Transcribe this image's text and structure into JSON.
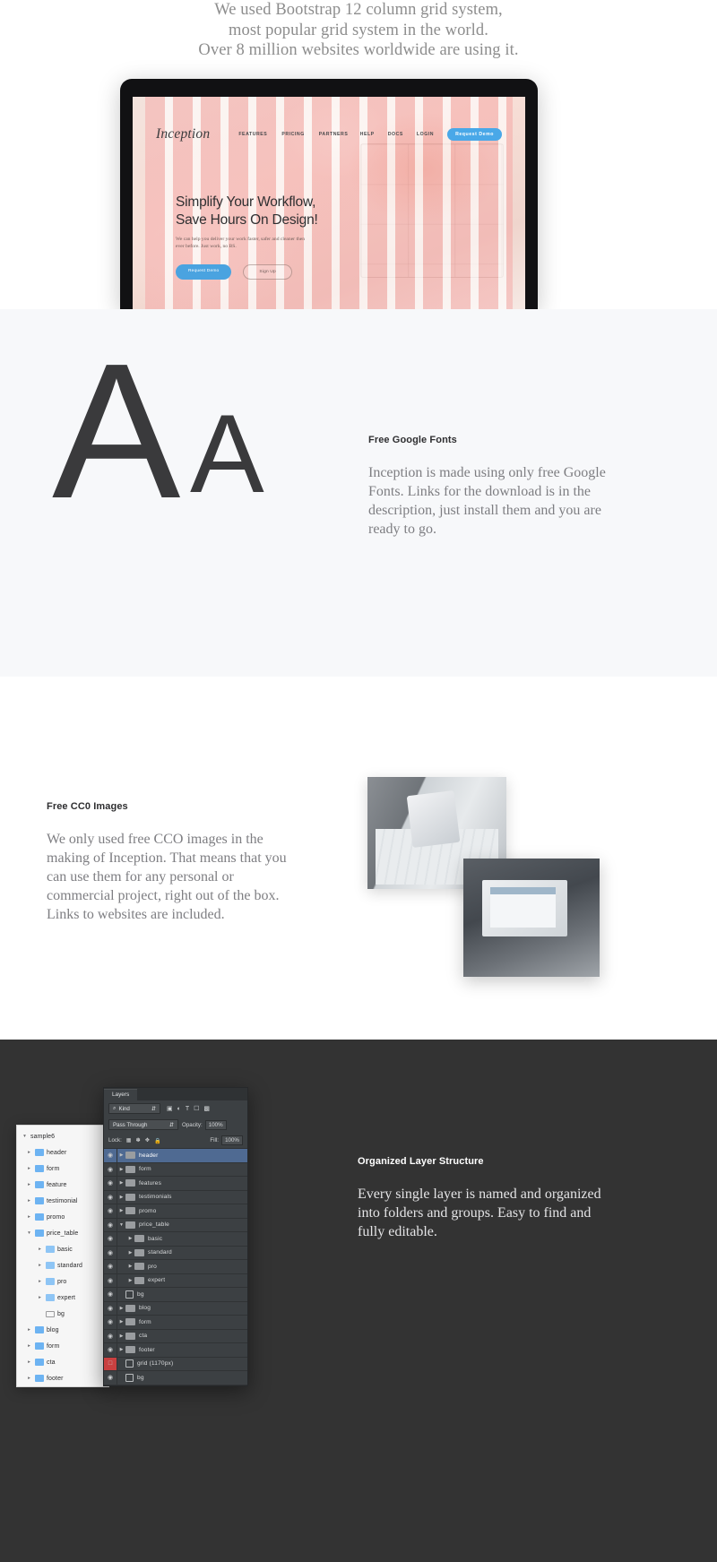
{
  "intro": {
    "lines": [
      "We used Bootstrap 12 column grid system,",
      "most popular grid system in the world.",
      "Over 8 million websites worldwide are using it."
    ]
  },
  "laptop": {
    "site": {
      "logo": "Inception",
      "nav_left": [
        "FEATURES",
        "PRICING",
        "PARTNERS"
      ],
      "nav_right": [
        "HELP",
        "DOCS",
        "LOGIN"
      ],
      "nav_cta": "Request Demo",
      "hero_title_line1": "Simplify Your Workflow,",
      "hero_title_line2": "Save Hours On Design!",
      "hero_sub": "We can help you deliver your work faster, safer and cleaner then ever before. Just work, no BS.",
      "btn_primary": "Request Demo",
      "btn_secondary": "Sign Up",
      "accent_color": "#49a8e8",
      "grid_color": "#f49696"
    }
  },
  "fonts_section": {
    "glyph_large": "A",
    "glyph_small": "A",
    "heading": "Free Google Fonts",
    "body": "Inception is made using only free Google Fonts. Links for the download is in the description, just install them and you are ready to go.",
    "background_color": "#f7f8fa"
  },
  "images_section": {
    "heading": "Free CC0 Images",
    "body": "We only used free CCO images in the making of Inception. That means that you can use them for any personal or commercial project, right out of the box. Links to websites are included.",
    "background_color": "#ffffff"
  },
  "dark_section": {
    "heading": "Organized Layer Structure",
    "body": "Every single layer is named and organized into folders and groups. Easy to find and fully editable.",
    "background_color": "#333333",
    "finder": {
      "root": "sample6",
      "items": [
        {
          "label": "header",
          "level": 1,
          "twisty": "▸",
          "kind": "folder"
        },
        {
          "label": "form",
          "level": 1,
          "twisty": "▸",
          "kind": "folder"
        },
        {
          "label": "feature",
          "level": 1,
          "twisty": "▸",
          "kind": "folder"
        },
        {
          "label": "testimonial",
          "level": 1,
          "twisty": "▸",
          "kind": "folder"
        },
        {
          "label": "promo",
          "level": 1,
          "twisty": "▸",
          "kind": "folder"
        },
        {
          "label": "price_table",
          "level": 1,
          "twisty": "▾",
          "kind": "folder"
        },
        {
          "label": "basic",
          "level": 2,
          "twisty": "▸",
          "kind": "folder"
        },
        {
          "label": "standard",
          "level": 2,
          "twisty": "▸",
          "kind": "folder"
        },
        {
          "label": "pro",
          "level": 2,
          "twisty": "▸",
          "kind": "folder"
        },
        {
          "label": "expert",
          "level": 2,
          "twisty": "▸",
          "kind": "folder"
        },
        {
          "label": "bg",
          "level": 2,
          "twisty": "",
          "kind": "empty"
        },
        {
          "label": "blog",
          "level": 1,
          "twisty": "▸",
          "kind": "folder"
        },
        {
          "label": "form",
          "level": 1,
          "twisty": "▸",
          "kind": "folder"
        },
        {
          "label": "cta",
          "level": 1,
          "twisty": "▸",
          "kind": "folder"
        },
        {
          "label": "footer",
          "level": 1,
          "twisty": "▸",
          "kind": "folder"
        }
      ]
    },
    "photoshop": {
      "tab": "Layers",
      "filter_label": "Kind",
      "filter_icons": [
        "pixel-icon",
        "adjustment-icon",
        "type-icon",
        "shape-icon",
        "smart-icon"
      ],
      "blend_mode": "Pass Through",
      "opacity_label": "Opacity:",
      "opacity_value": "100%",
      "lock_label": "Lock:",
      "lock_icons": [
        "transparency-icon",
        "brush-icon",
        "move-icon",
        "lock-icon"
      ],
      "fill_label": "Fill:",
      "fill_value": "100%",
      "layers": [
        {
          "name": "header",
          "indent": 0,
          "type": "group",
          "selected": true,
          "visible": true
        },
        {
          "name": "form",
          "indent": 0,
          "type": "group",
          "selected": false,
          "visible": true
        },
        {
          "name": "features",
          "indent": 0,
          "type": "group",
          "selected": false,
          "visible": true
        },
        {
          "name": "testimonials",
          "indent": 0,
          "type": "group",
          "selected": false,
          "visible": true
        },
        {
          "name": "promo",
          "indent": 0,
          "type": "group",
          "selected": false,
          "visible": true
        },
        {
          "name": "price_table",
          "indent": 0,
          "type": "group-open",
          "selected": false,
          "visible": true
        },
        {
          "name": "basic",
          "indent": 1,
          "type": "group",
          "selected": false,
          "visible": true
        },
        {
          "name": "standard",
          "indent": 1,
          "type": "group",
          "selected": false,
          "visible": true
        },
        {
          "name": "pro",
          "indent": 1,
          "type": "group",
          "selected": false,
          "visible": true
        },
        {
          "name": "expert",
          "indent": 1,
          "type": "group",
          "selected": false,
          "visible": true
        },
        {
          "name": "bg",
          "indent": 0,
          "type": "shape",
          "selected": false,
          "visible": true
        },
        {
          "name": "blog",
          "indent": 0,
          "type": "group",
          "selected": false,
          "visible": true
        },
        {
          "name": "form",
          "indent": 0,
          "type": "group",
          "selected": false,
          "visible": true
        },
        {
          "name": "cta",
          "indent": 0,
          "type": "group",
          "selected": false,
          "visible": true
        },
        {
          "name": "footer",
          "indent": 0,
          "type": "group",
          "selected": false,
          "visible": true
        },
        {
          "name": "grid (1170px)",
          "indent": 0,
          "type": "shape",
          "selected": false,
          "visible": false,
          "highlight": "#c94040"
        },
        {
          "name": "bg",
          "indent": 0,
          "type": "shape",
          "selected": false,
          "visible": true
        }
      ]
    }
  }
}
